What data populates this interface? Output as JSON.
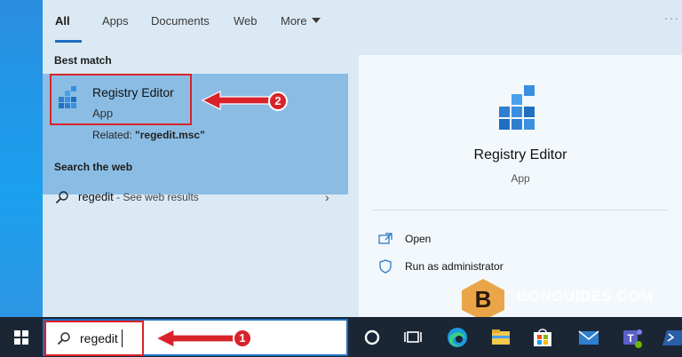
{
  "tabs": [
    {
      "label": "All"
    },
    {
      "label": "Apps"
    },
    {
      "label": "Documents"
    },
    {
      "label": "Web"
    },
    {
      "label": "More"
    }
  ],
  "more_options_icon": "ellipsis-icon",
  "best_match": {
    "section_label": "Best match",
    "name": "Registry Editor",
    "type": "App",
    "related_prefix": "Related: ",
    "related_value": "\"regedit.msc\"",
    "icon": "registry-editor-icon"
  },
  "web": {
    "section_label": "Search the web",
    "query": "regedit",
    "suffix": " - See web results",
    "icon": "search-icon"
  },
  "detail": {
    "title": "Registry Editor",
    "type": "App",
    "actions": [
      {
        "label": "Open",
        "icon": "open-icon"
      },
      {
        "label": "Run as administrator",
        "icon": "shield-icon"
      }
    ]
  },
  "search": {
    "value": "regedit"
  },
  "annotations": {
    "step1": "1",
    "step2": "2"
  },
  "watermark": {
    "letter": "B",
    "text": "BONGUIDES.COM"
  },
  "colors": {
    "accent": "#1f6fc1",
    "highlight_border": "#d8232a",
    "best_match_bg": "#8bbde4",
    "panel_bg": "#dbe9f4",
    "taskbar_bg": "#1b2635"
  }
}
